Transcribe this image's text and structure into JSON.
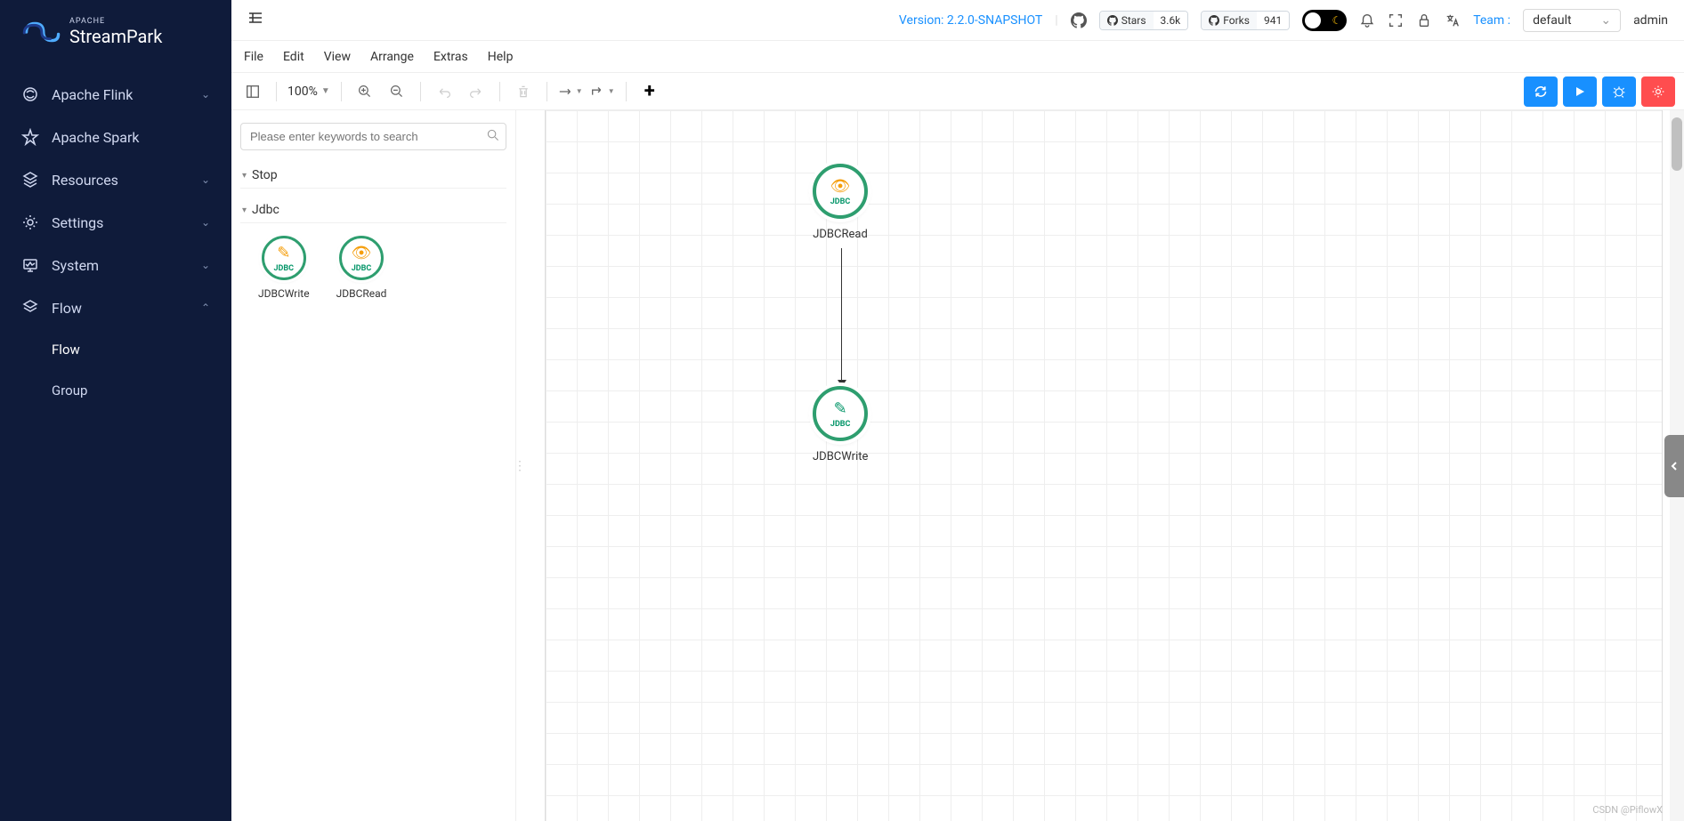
{
  "brand": {
    "apache": "APACHE",
    "name": "StreamPark"
  },
  "sidebar": {
    "items": [
      {
        "label": "Apache Flink"
      },
      {
        "label": "Apache Spark"
      },
      {
        "label": "Resources"
      },
      {
        "label": "Settings"
      },
      {
        "label": "System"
      },
      {
        "label": "Flow"
      }
    ],
    "flow_sub": [
      {
        "label": "Flow"
      },
      {
        "label": "Group"
      }
    ]
  },
  "header": {
    "version": "Version: 2.2.0-SNAPSHOT",
    "stars_label": "Stars",
    "stars_count": "3.6k",
    "forks_label": "Forks",
    "forks_count": "941",
    "team_label": "Team :",
    "team_value": "default",
    "user": "admin"
  },
  "editor_menu": [
    "File",
    "Edit",
    "View",
    "Arrange",
    "Extras",
    "Help"
  ],
  "toolbar": {
    "zoom": "100%"
  },
  "palette": {
    "search_placeholder": "Please enter keywords to search",
    "cat_stop": "Stop",
    "cat_jdbc": "Jdbc",
    "nodes": [
      {
        "label": "JDBCWrite",
        "icon_text": "JDBC"
      },
      {
        "label": "JDBCRead",
        "icon_text": "JDBC"
      }
    ]
  },
  "canvas": {
    "node_read": {
      "label": "JDBCRead",
      "icon_text": "JDBC"
    },
    "node_write": {
      "label": "JDBCWrite",
      "icon_text": "JDBC"
    }
  },
  "watermark": "CSDN @PiflowX"
}
